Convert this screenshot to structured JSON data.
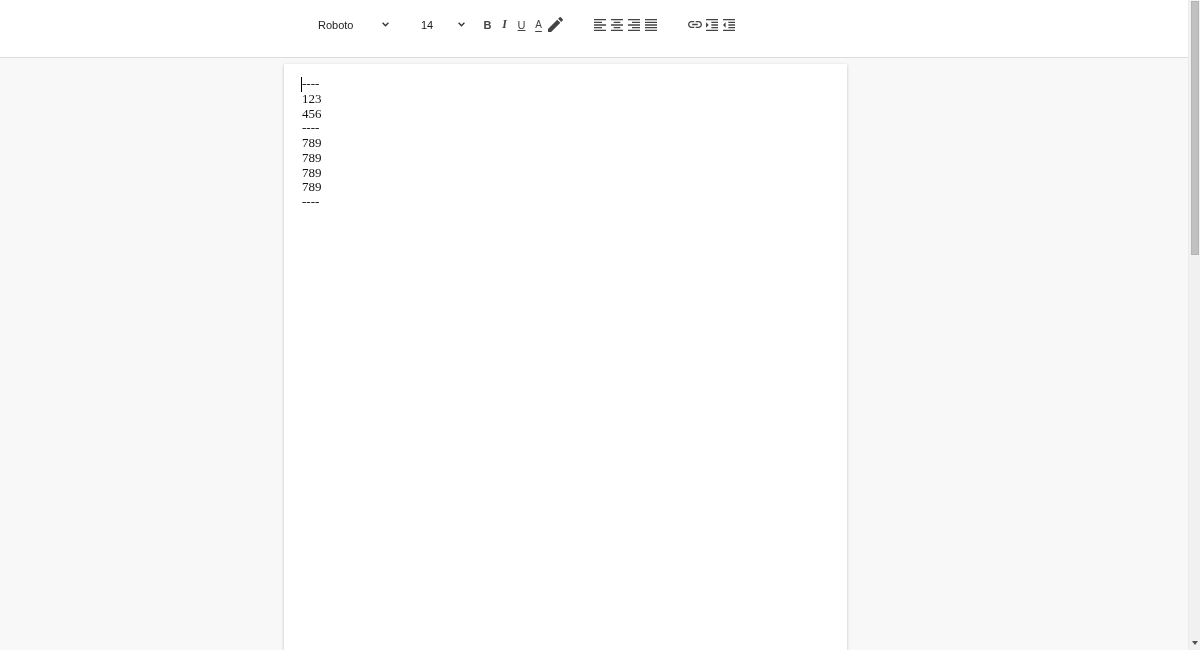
{
  "toolbar": {
    "font_family": {
      "value": "Roboto"
    },
    "font_size": {
      "value": "14"
    },
    "format_buttons": [
      {
        "kind": "bold",
        "label": "B"
      },
      {
        "kind": "italic",
        "label": "I"
      },
      {
        "kind": "underline",
        "label": "U"
      },
      {
        "kind": "text_color",
        "label": "A"
      },
      {
        "kind": "highlight"
      }
    ],
    "align_buttons": [
      {
        "kind": "left"
      },
      {
        "kind": "center"
      },
      {
        "kind": "right"
      },
      {
        "kind": "justify"
      }
    ],
    "insert_buttons": [
      {
        "kind": "link"
      },
      {
        "kind": "indent"
      },
      {
        "kind": "outdent"
      }
    ]
  },
  "document": {
    "lines": [
      {
        "text": "----",
        "caret": true
      },
      {
        "text": "123",
        "caret": false
      },
      {
        "text": "456",
        "caret": false
      },
      {
        "text": "----",
        "caret": false
      },
      {
        "text": "789",
        "caret": false
      },
      {
        "text": "789",
        "caret": false
      },
      {
        "text": "789",
        "caret": false
      },
      {
        "text": "789",
        "caret": false
      },
      {
        "text": "----",
        "caret": false
      }
    ]
  }
}
